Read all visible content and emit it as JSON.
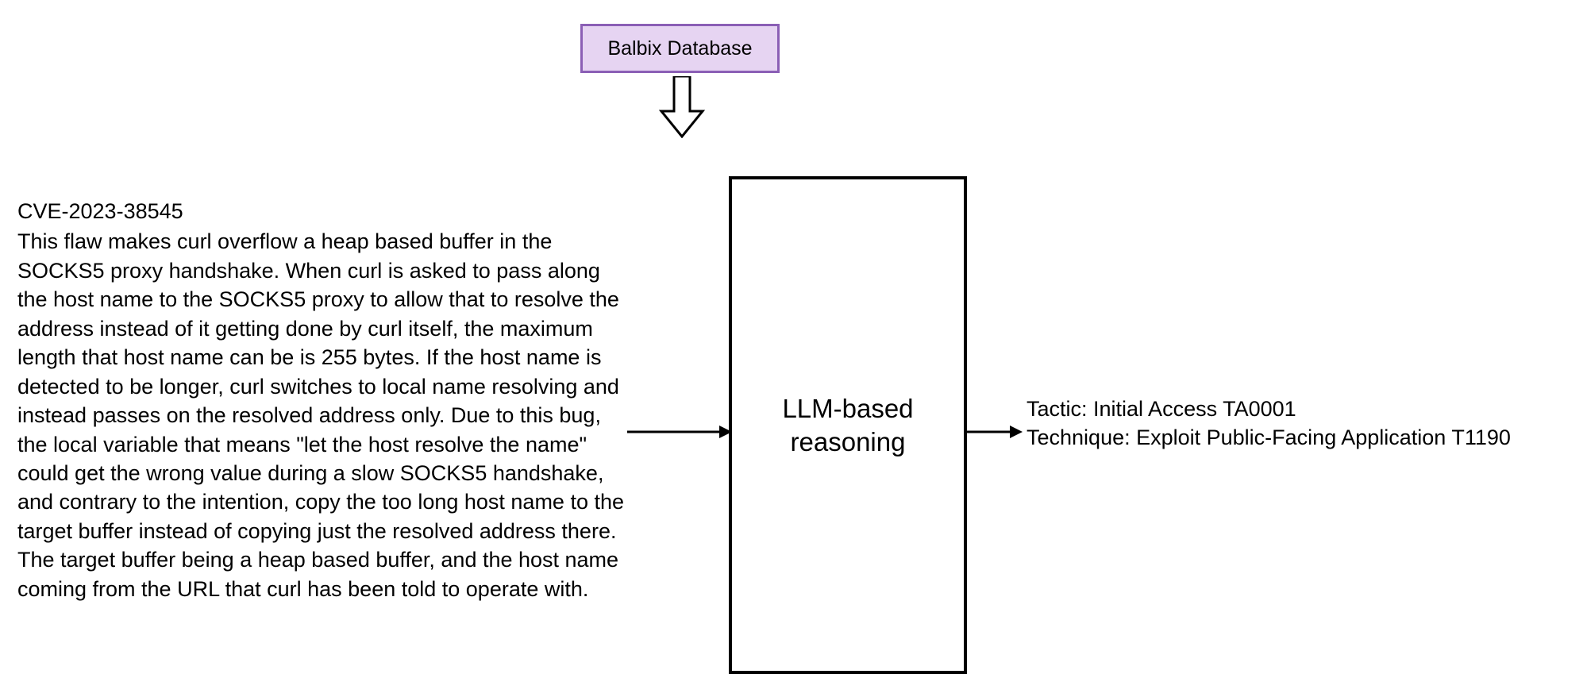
{
  "database": {
    "label": "Balbix Database",
    "fill": "#e6d4f2",
    "border": "#8b5fb5"
  },
  "input": {
    "cve_id": "CVE-2023-38545",
    "description": "This flaw makes curl overflow a heap based buffer in the SOCKS5 proxy handshake. When curl is asked to pass along the host name to the SOCKS5 proxy to allow that to resolve the address instead of it getting done by curl itself, the maximum length that host name can be is 255 bytes. If the host name is detected to be longer, curl switches to local name resolving and instead passes on the resolved address only. Due to this bug, the local variable that means \"let the host resolve the name\" could get the wrong value during a slow SOCKS5 handshake, and contrary to the intention, copy the too long host name to the target buffer instead of copying just the resolved address there. The target buffer being a heap based buffer, and the host name coming from the URL that curl has been told to operate with."
  },
  "reasoning": {
    "label": "LLM-based reasoning"
  },
  "output": {
    "tactic_line": "Tactic: Initial Access TA0001",
    "technique_line": "Technique: Exploit Public-Facing Application T1190"
  }
}
